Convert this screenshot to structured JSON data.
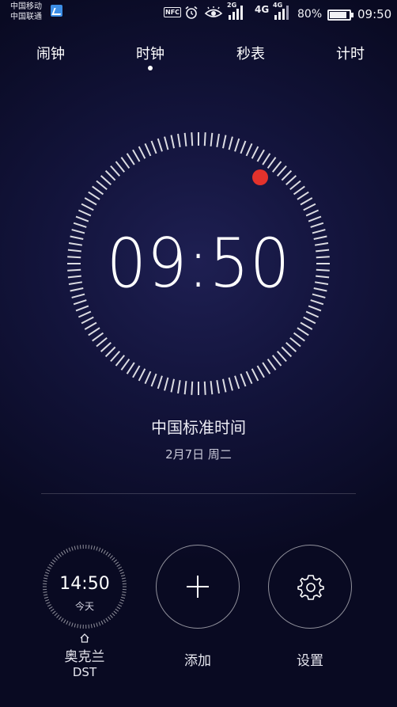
{
  "status_bar": {
    "carrier_1": "中国移动",
    "carrier_2": "中国联通",
    "nfc": "NFC",
    "net_type_1": "2G",
    "net_type_2": "4G",
    "net_type_3": "4G",
    "battery_percent": "80%",
    "time": "09:50"
  },
  "tabs": [
    {
      "label": "闹钟"
    },
    {
      "label": "时钟"
    },
    {
      "label": "秒表"
    },
    {
      "label": "计时"
    }
  ],
  "clock": {
    "time": "09:50",
    "timezone": "中国标准时间",
    "date": "2月7日 周二",
    "accent_color": "#e3322c"
  },
  "world_clock": {
    "time": "14:50",
    "day": "今天",
    "city": "奥克兰",
    "dst": "DST"
  },
  "actions": {
    "add_label": "添加",
    "settings_label": "设置"
  }
}
